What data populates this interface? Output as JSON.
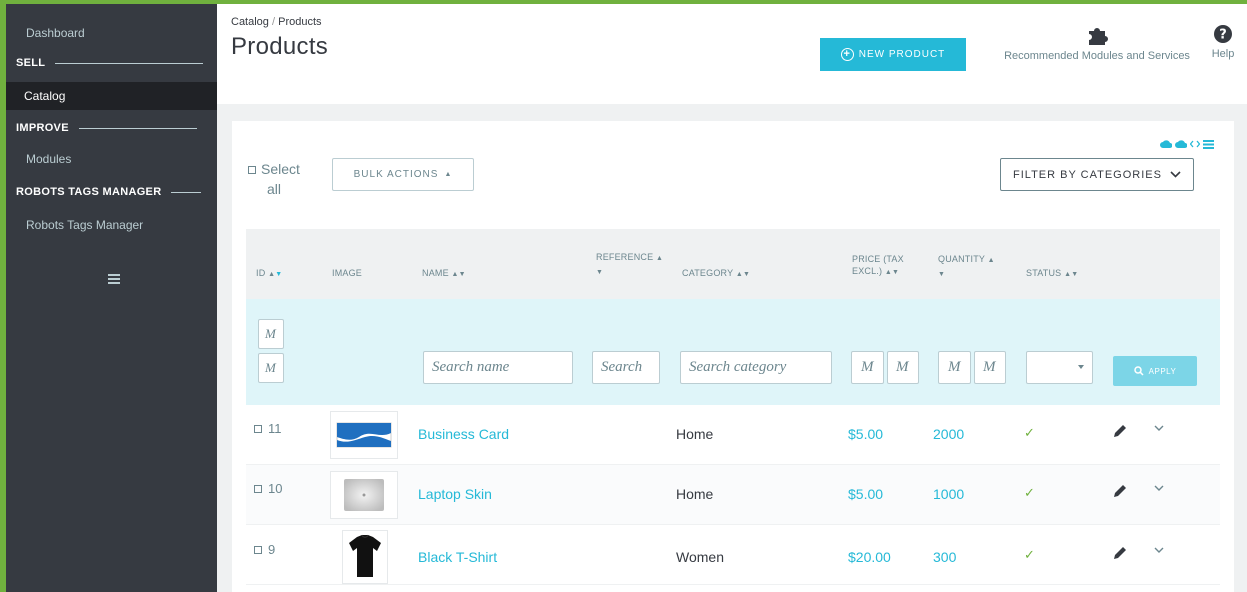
{
  "sidebar": {
    "dashboard": "Dashboard",
    "sell": "SELL",
    "catalog": "Catalog",
    "improve": "IMPROVE",
    "modules": "Modules",
    "robots_section": "ROBOTS TAGS MANAGER",
    "robots_item": "Robots Tags Manager"
  },
  "header": {
    "breadcrumb_parent": "Catalog",
    "breadcrumb_sep": "/",
    "breadcrumb_current": "Products",
    "title": "Products",
    "new_product": "NEW PRODUCT",
    "recommended": "Recommended Modules and Services",
    "help": "Help"
  },
  "toolbar": {
    "select_all_1": "Select",
    "select_all_2": "all",
    "bulk_actions": "BULK ACTIONS",
    "filter_categories": "FILTER BY CATEGORIES"
  },
  "columns": {
    "id": "ID",
    "image": "IMAGE",
    "name": "NAME",
    "reference": "REFERENCE",
    "category": "CATEGORY",
    "price_1": "PRICE (TAX",
    "price_2": "EXCL.)",
    "quantity": "QUANTITY",
    "status": "STATUS"
  },
  "filters": {
    "id_min": "M",
    "id_max": "M",
    "name_placeholder": "Search name",
    "reference_placeholder": "Search",
    "category_placeholder": "Search category",
    "price_min": "M",
    "price_max": "M",
    "qty_min": "M",
    "qty_max": "M",
    "apply": "APPLY"
  },
  "products": [
    {
      "id": "11",
      "name": "Business Card",
      "category": "Home",
      "price": "$5.00",
      "quantity": "2000",
      "status": "✓",
      "thumb": "card"
    },
    {
      "id": "10",
      "name": "Laptop Skin",
      "category": "Home",
      "price": "$5.00",
      "quantity": "1000",
      "status": "✓",
      "thumb": "laptop"
    },
    {
      "id": "9",
      "name": "Black T-Shirt",
      "category": "Women",
      "price": "$20.00",
      "quantity": "300",
      "status": "✓",
      "thumb": "tshirt"
    }
  ],
  "colors": {
    "accent": "#25b9d7",
    "sidebar": "#363a41",
    "frame": "#70b13e"
  }
}
